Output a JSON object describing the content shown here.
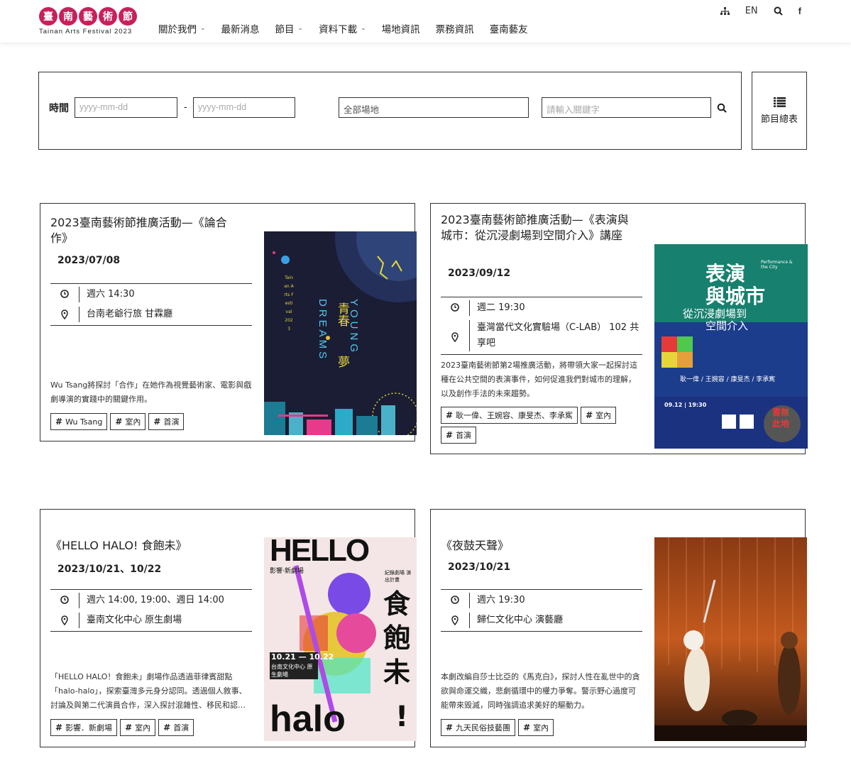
{
  "header": {
    "logo_chars": [
      "臺",
      "南",
      "藝",
      "術",
      "節"
    ],
    "logo_sub": "Tainan Arts Festival 2023",
    "nav": [
      {
        "label": "關於我們",
        "caret": true
      },
      {
        "label": "最新消息",
        "caret": false
      },
      {
        "label": "節目",
        "caret": true
      },
      {
        "label": "資料下載",
        "caret": true
      },
      {
        "label": "場地資訊",
        "caret": false
      },
      {
        "label": "票務資訊",
        "caret": false
      },
      {
        "label": "臺南藝友",
        "caret": false
      }
    ],
    "caret_glyph": "⌄",
    "lang": "EN",
    "facebook": "f",
    "accent": "#c8205b"
  },
  "filter": {
    "time_label": "時間",
    "date_from_placeholder": "yyyy-mm-dd",
    "dash": "-",
    "date_to_placeholder": "yyyy-mm-dd",
    "venue_value": "全部場地",
    "keyword_placeholder": "請輸入關鍵字",
    "list_label": "節目總表"
  },
  "cards": [
    {
      "title": "2023臺南藝術節推廣活動—《論合作》",
      "date": "2023/07/08",
      "time": "週六 14:30",
      "venue": "台南老爺行旅 甘霖廳",
      "desc": "Wu Tsang將探討「合作」在她作為視覺藝術家、電影與戲劇導演的實踐中的關鍵作用。",
      "tags": [
        "Wu Tsang",
        "室內",
        "首演"
      ],
      "poster": {
        "tainan": "Tainan Arts Festival 2023",
        "young": "YOUNG",
        "dreams": "DREAMS",
        "cn1": "青春",
        "cn2": "夢"
      }
    },
    {
      "title": "2023臺南藝術節推廣活動—《表演與城市：從沉浸劇場到空間介入》講座",
      "date": "2023/09/12",
      "time": "週二 19:30",
      "venue": "臺灣當代文化實驗場（C-LAB） 102 共享吧",
      "desc": "2023臺南藝術節第2場推廣活動，將帶領大家一起探討這種在公共空間的表演事件，如何促進我們對城市的理解，以及創作手法的未來趨勢。",
      "tags": [
        "耿一偉、王婉容、康旻杰、李承寯",
        "室內",
        "首演"
      ],
      "poster": {
        "t1": "表演",
        "t2": "與城市",
        "t3": "從沉浸劇場到",
        "t4": "空間介入",
        "en": "Performance & the City",
        "speakers": "耿一偉 / 王婉容 / 康旻杰 / 李承寯",
        "date": "09.12 | 19:30",
        "stamp1": "喜無",
        "stamp2": "此地"
      }
    },
    {
      "title": "《HELLO HALO! 食飽未》",
      "date": "2023/10/21、10/22",
      "time": "週六 14:00, 19:00、週日 14:00",
      "venue": "臺南文化中心 原生劇場",
      "desc": "「HELLO HALO！食飽未」劇場作品透過菲律賓甜點「halo-halo」，探索臺灣多元身分認同。透過個人敘事、討論及與第二代演員合作，深入探討混雜性、移民和認…",
      "tags": [
        "影響．新劇場",
        "室內",
        "首演"
      ],
      "poster": {
        "hello": "HELLO",
        "halo": "halo",
        "cn": "食飽未",
        "bang": "!",
        "company": "影響·新劇場",
        "plan": "紀錄劇場 演出計畫",
        "dates": "10.21 — 10.22",
        "venue": "台南文化中心 原生劇場"
      }
    },
    {
      "title": "《夜鼓天聲》",
      "date": "2023/10/21",
      "time": "週六 19:30",
      "venue": "歸仁文化中心 演藝廳",
      "desc": "本劇改編自莎士比亞的《馬克白》，探討人性在亂世中的貪欲與命運交織，悲劇循環中的權力爭奪。警示野心過度可能帶來毀滅，同時強調追求美好的驅動力。",
      "tags": [
        "九天民俗技藝團",
        "室內"
      ],
      "poster": {}
    }
  ]
}
